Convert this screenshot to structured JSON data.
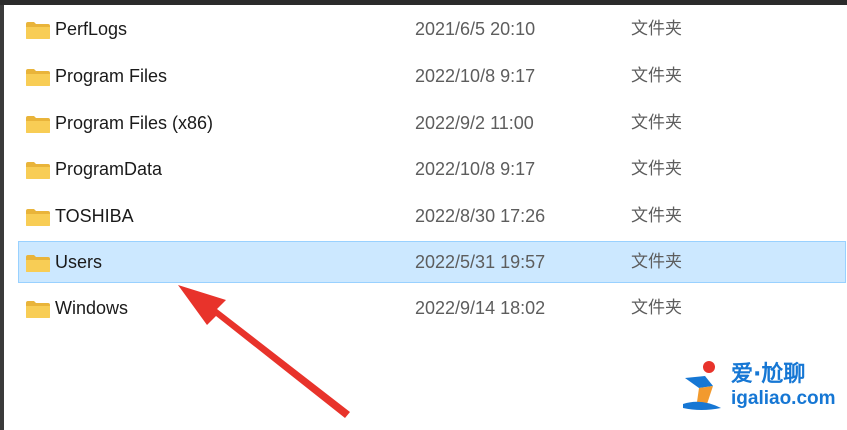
{
  "files": [
    {
      "name": "PerfLogs",
      "date": "2021/6/5 20:10",
      "type": "文件夹",
      "selected": false
    },
    {
      "name": "Program Files",
      "date": "2022/10/8 9:17",
      "type": "文件夹",
      "selected": false
    },
    {
      "name": "Program Files (x86)",
      "date": "2022/9/2 11:00",
      "type": "文件夹",
      "selected": false
    },
    {
      "name": "ProgramData",
      "date": "2022/10/8 9:17",
      "type": "文件夹",
      "selected": false
    },
    {
      "name": "TOSHIBA",
      "date": "2022/8/30 17:26",
      "type": "文件夹",
      "selected": false
    },
    {
      "name": "Users",
      "date": "2022/5/31 19:57",
      "type": "文件夹",
      "selected": true
    },
    {
      "name": "Windows",
      "date": "2022/9/14 18:02",
      "type": "文件夹",
      "selected": false
    }
  ],
  "icon": "folder-icon",
  "colors": {
    "selection_bg": "#cce8ff",
    "selection_border": "#99d1ff",
    "folder": "#f5c64e",
    "arrow": "#e8332b",
    "brand": "#1677d4"
  },
  "watermark": {
    "title": "爱·尬聊",
    "url": "igaliao.com"
  }
}
